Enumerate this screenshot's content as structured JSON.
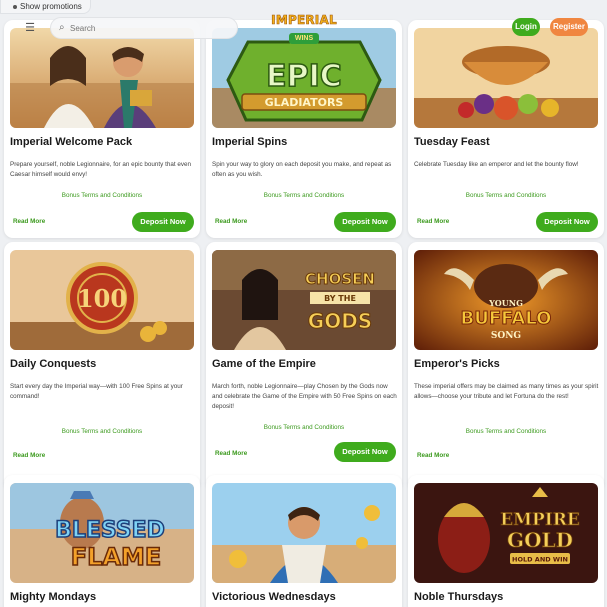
{
  "promo_toggle": {
    "label": "Show promotions"
  },
  "search": {
    "placeholder": "Search"
  },
  "logo": {
    "line1": "IMPERIAL",
    "line2": "WINS"
  },
  "header": {
    "login": "Login",
    "register": "Register"
  },
  "common": {
    "terms": "Bonus Terms and Conditions",
    "read_more": "Read More",
    "deposit": "Deposit Now"
  },
  "cards": [
    {
      "title": "Imperial Welcome Pack",
      "description": "Prepare yourself, noble Legionnaire, for an epic bounty that even Caesar himself would envy!",
      "image_text": ""
    },
    {
      "title": "Imperial Spins",
      "description": "Spin your way to glory on each deposit you make, and repeat as often as you wish.",
      "image_text": "EPIC GLADIATORS"
    },
    {
      "title": "Tuesday Feast",
      "description": "Celebrate Tuesday like an emperor and let the bounty flow!",
      "image_text": ""
    },
    {
      "title": "Daily Conquests",
      "description": "Start every day the Imperial way—with 100 Free Spins at your command!",
      "image_text": "100"
    },
    {
      "title": "Game of the Empire",
      "description": "March forth, noble Legionnaire—play Chosen by the Gods now and celebrate the Game of the Empire with 50 Free Spins on each deposit!",
      "image_text": "CHOSEN BY THE GODS"
    },
    {
      "title": "Emperor's Picks",
      "description": "These imperial offers may be claimed as many times as your spirit allows—choose your tribute and let Fortuna do the rest!",
      "image_text": "YOUNG BUFFALO SONG"
    },
    {
      "title": "Mighty Mondays",
      "description": "",
      "image_text": "BLESSED FLAME"
    },
    {
      "title": "Victorious Wednesdays",
      "description": "",
      "image_text": ""
    },
    {
      "title": "Noble Thursdays",
      "description": "",
      "image_text": "EMPIRE GOLD HOLD AND WIN"
    }
  ],
  "colors": {
    "accent_green": "#3fab1d",
    "register_orange": "#f08640",
    "link_green": "#3c9a1e"
  }
}
